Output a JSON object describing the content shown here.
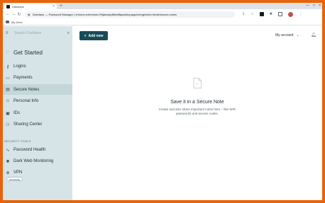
{
  "browser": {
    "tab_title": "Dashlane",
    "tab_close": "×",
    "new_tab": "+",
    "window_controls": [
      "—",
      "□",
      "×"
    ],
    "url": "chrome-extension://fdjamakpfbbddfjaooikfcpapjohcfmg/index.html#/secure-notes",
    "url_prefix_label": "Dashlane — Password Manager",
    "bookmark": "My Drive"
  },
  "sidebar": {
    "search_placeholder": "Search Dashlane",
    "top_item": "Get Started",
    "items": [
      {
        "label": "Logins",
        "icon": "key-icon"
      },
      {
        "label": "Payments",
        "icon": "card-icon"
      },
      {
        "label": "Secure Notes",
        "icon": "note-icon"
      },
      {
        "label": "Personal Info",
        "icon": "person-icon"
      },
      {
        "label": "IDs",
        "icon": "id-icon"
      },
      {
        "label": "Sharing Center",
        "icon": "sharing-icon"
      }
    ],
    "section_label": "SECURITY TOOLS",
    "tools": [
      {
        "label": "Password Health",
        "icon": "pulse-icon"
      },
      {
        "label": "Dark Web Monitoring",
        "icon": "radar-icon"
      },
      {
        "label": "VPN",
        "icon": "vpn-icon"
      }
    ],
    "upgrade_badge": "UPGRADE"
  },
  "header": {
    "add_new_label": "Add new",
    "account_label": "My account"
  },
  "empty_state": {
    "title": "Save it in a Secure Note",
    "description": "Create and also share important notes here – like WiFi passwords and access codes."
  },
  "colors": {
    "brand": "#184b59",
    "sidebar_bg": "#d7e4e7",
    "active_item_bg": "#c4d6da",
    "outer_border": "#e8630a"
  }
}
